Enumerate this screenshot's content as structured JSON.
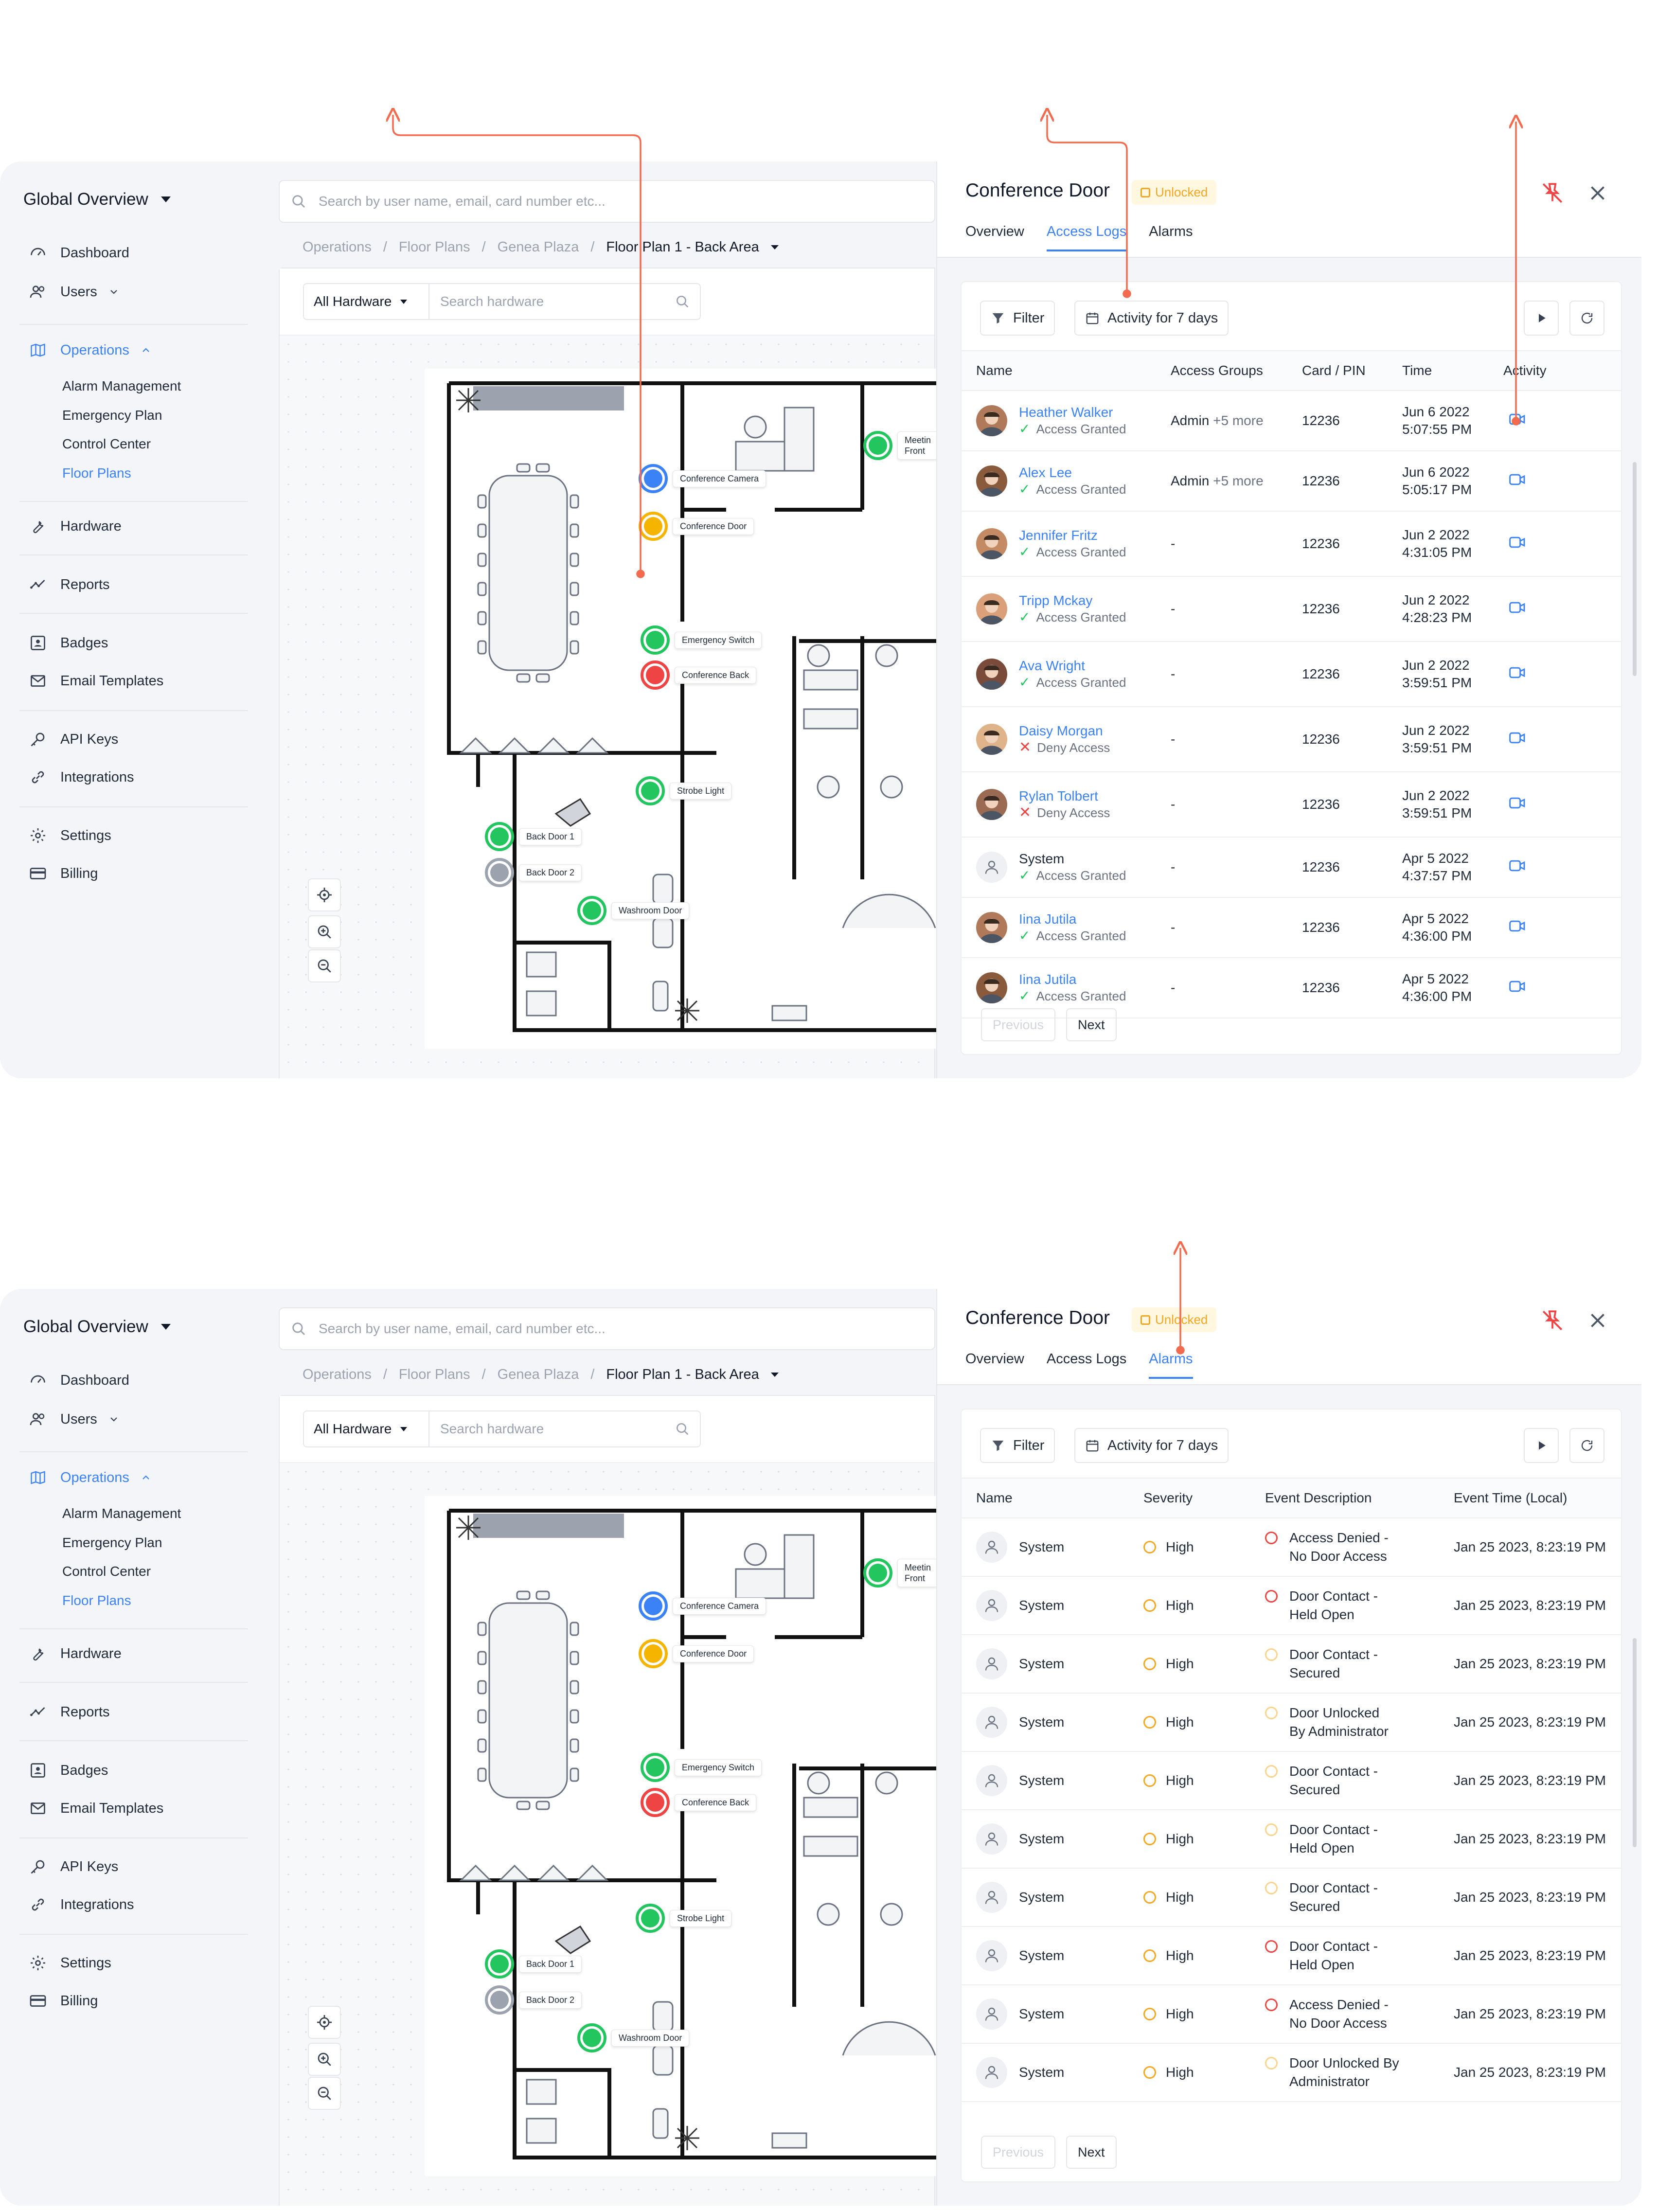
{
  "sidebar": {
    "workspace_label": "Global Overview",
    "nav": {
      "dashboard": "Dashboard",
      "users": "Users",
      "operations": "Operations",
      "alarm_management": "Alarm Management",
      "emergency_plan": "Emergency Plan",
      "control_center": "Control Center",
      "floor_plans": "Floor Plans",
      "hardware": "Hardware",
      "reports": "Reports",
      "badges": "Badges",
      "email_templates": "Email Templates",
      "api_keys": "API Keys",
      "integrations": "Integrations",
      "settings": "Settings",
      "billing": "Billing"
    }
  },
  "search": {
    "placeholder": "Search by user name, email, card number etc..."
  },
  "breadcrumb": {
    "operations": "Operations",
    "floor_plans": "Floor Plans",
    "site": "Genea Plaza",
    "current": "Floor Plan 1 - Back Area"
  },
  "map_toolbar": {
    "hardware_filter": "All Hardware",
    "hardware_search_placeholder": "Search hardware"
  },
  "markers": {
    "conference_camera": "Conference Camera",
    "conference_door": "Conference Door",
    "meeting": "Meetin",
    "front": "Front",
    "emergency_switch": "Emergency Switch",
    "conference_back": "Conference Back",
    "strobe_light": "Strobe Light",
    "back_door_1": "Back Door 1",
    "back_door_2": "Back Door 2",
    "washroom_door": "Washroom Door"
  },
  "panel": {
    "title": "Conference Door",
    "status_badge": "Unlocked",
    "tabs": {
      "overview": "Overview",
      "access_logs": "Access Logs",
      "alarms": "Alarms"
    },
    "filter_label": "Filter",
    "date_range": "Activity for 7 days",
    "pager": {
      "previous": "Previous",
      "next": "Next"
    }
  },
  "access_logs": {
    "columns": {
      "name": "Name",
      "access_groups": "Access Groups",
      "card_pin": "Card / PIN",
      "time": "Time",
      "activity": "Activity"
    },
    "rows": [
      {
        "name": "Heather Walker",
        "status": "Access Granted",
        "group": "Admin",
        "more": "+5 more",
        "card": "12236",
        "date": "Jun 6 2022",
        "time": "5:07:55 PM"
      },
      {
        "name": "Alex Lee",
        "status": "Access Granted",
        "group": "Admin",
        "more": "+5 more",
        "card": "12236",
        "date": "Jun 6 2022",
        "time": "5:05:17 PM"
      },
      {
        "name": "Jennifer Fritz",
        "status": "Access Granted",
        "group": "-",
        "more": "",
        "card": "12236",
        "date": "Jun 2 2022",
        "time": "4:31:05 PM"
      },
      {
        "name": "Tripp Mckay",
        "status": "Access Granted",
        "group": "-",
        "more": "",
        "card": "12236",
        "date": "Jun 2 2022",
        "time": "4:28:23 PM"
      },
      {
        "name": "Ava Wright",
        "status": "Access Granted",
        "group": "-",
        "more": "",
        "card": "12236",
        "date": "Jun 2 2022",
        "time": "3:59:51 PM"
      },
      {
        "name": "Daisy Morgan",
        "status": "Deny Access",
        "group": "-",
        "more": "",
        "card": "12236",
        "date": "Jun 2 2022",
        "time": "3:59:51 PM"
      },
      {
        "name": "Rylan Tolbert",
        "status": "Deny Access",
        "group": "-",
        "more": "",
        "card": "12236",
        "date": "Jun 2 2022",
        "time": "3:59:51 PM"
      },
      {
        "name": "System",
        "status": "Access Granted",
        "group": "-",
        "more": "",
        "card": "12236",
        "date": "Apr 5 2022",
        "time": "4:37:57 PM"
      },
      {
        "name": "Iina Jutila",
        "status": "Access Granted",
        "group": "-",
        "more": "",
        "card": "12236",
        "date": "Apr 5 2022",
        "time": "4:36:00 PM"
      },
      {
        "name": "Iina Jutila",
        "status": "Access Granted",
        "group": "-",
        "more": "",
        "card": "12236",
        "date": "Apr 5 2022",
        "time": "4:36:00 PM"
      }
    ]
  },
  "alarms": {
    "columns": {
      "name": "Name",
      "severity": "Severity",
      "event_description": "Event Description",
      "event_time": "Event Time (Local)"
    },
    "rows": [
      {
        "name": "System",
        "severity": "High",
        "line1": "Access Denied -",
        "line2": "No Door Access",
        "time": "Jan 25 2023, 8:23:19 PM",
        "ring": "#ef4444"
      },
      {
        "name": "System",
        "severity": "High",
        "line1": "Door Contact -",
        "line2": "Held Open",
        "time": "Jan 25 2023, 8:23:19 PM",
        "ring": "#ef4444"
      },
      {
        "name": "System",
        "severity": "High",
        "line1": "Door Contact -",
        "line2": "Secured",
        "time": "Jan 25 2023, 8:23:19 PM",
        "ring": "#fbd38d"
      },
      {
        "name": "System",
        "severity": "High",
        "line1": "Door Unlocked",
        "line2": "By Administrator",
        "time": "Jan 25 2023, 8:23:19 PM",
        "ring": "#fbd38d"
      },
      {
        "name": "System",
        "severity": "High",
        "line1": "Door Contact -",
        "line2": "Secured",
        "time": "Jan 25 2023, 8:23:19 PM",
        "ring": "#fbd38d"
      },
      {
        "name": "System",
        "severity": "High",
        "line1": "Door Contact -",
        "line2": "Held Open",
        "time": "Jan 25 2023, 8:23:19 PM",
        "ring": "#fbd38d"
      },
      {
        "name": "System",
        "severity": "High",
        "line1": "Door Contact -",
        "line2": "Secured",
        "time": "Jan 25 2023, 8:23:19 PM",
        "ring": "#fbd38d"
      },
      {
        "name": "System",
        "severity": "High",
        "line1": "Door Contact -",
        "line2": "Held Open",
        "time": "Jan 25 2023, 8:23:19 PM",
        "ring": "#ef4444"
      },
      {
        "name": "System",
        "severity": "High",
        "line1": "Access Denied -",
        "line2": "No Door Access",
        "time": "Jan 25 2023, 8:23:19 PM",
        "ring": "#ef4444"
      },
      {
        "name": "System",
        "severity": "High",
        "line1": "Door Unlocked By",
        "line2": "Administrator",
        "time": "Jan 25 2023, 8:23:19 PM",
        "ring": "#fbd38d"
      }
    ]
  },
  "colors": {
    "accent": "#3b82f6",
    "granted": "#22c55e",
    "denied": "#ef4444",
    "warning": "#f5a623",
    "annotation": "#f26b4f"
  }
}
